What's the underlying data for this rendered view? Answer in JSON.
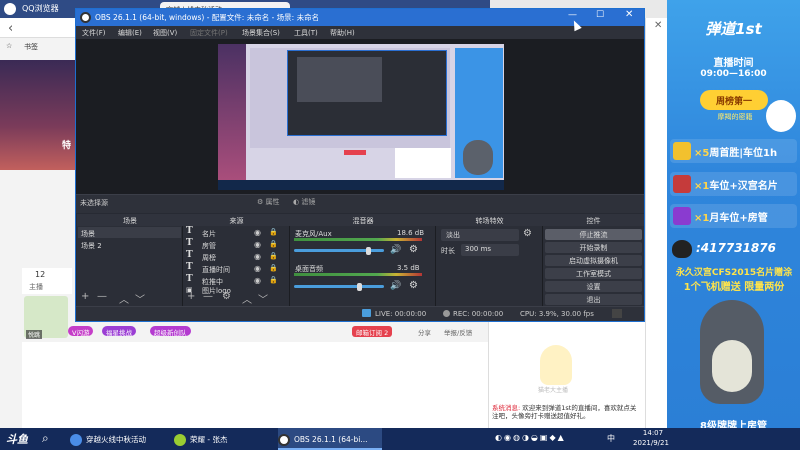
{
  "browser": {
    "app_name": "QQ浏览器",
    "tab_title": "穿越火线中秋活动",
    "bookmark_label": "书签",
    "hero_badge": "特",
    "stat_value": "12",
    "stat_label": "主播",
    "avatar_caption": "悦跳",
    "tags": [
      "V闪游",
      "福星挑战",
      "超级新创队"
    ],
    "share_button": "邮箱订阅 2",
    "share_label": "分享",
    "report_label": "举报/反馈",
    "mascot_caption": "猫老大主播",
    "chat_system_label": "系统消息:",
    "chat_message": "欢迎来到弹道1st的直播间，喜欢就点关注吧，头像旁打卡赠送超值好礼。"
  },
  "live_panel": {
    "title": "弹道1st",
    "time_label": "直播时间",
    "time_value": "09:00—16:00",
    "weekly_badge": "周榜第一",
    "weekly_sub": "摩羯的密籍",
    "rows": [
      {
        "mult": "×5",
        "text": "周首胜|车位1h"
      },
      {
        "mult": "×1",
        "text": "车位+汉宫名片"
      },
      {
        "mult": "×1",
        "text": "月车位+房管"
      }
    ],
    "qq": ":417731876",
    "promo_line1": "永久汉宫CFS2015名片赠涂",
    "promo_line2": "1个飞机赠送  限量两份",
    "footer": "8级牌牌上房管"
  },
  "obs": {
    "title": "OBS 26.1.1 (64-bit, windows) - 配置文件: 未命名 - 场景: 未命名",
    "menu": [
      {
        "label": "文件(F)",
        "dim": false
      },
      {
        "label": "编辑(E)",
        "dim": false
      },
      {
        "label": "视图(V)",
        "dim": false
      },
      {
        "label": "固定文件(P)",
        "dim": true
      },
      {
        "label": "场景集合(S)",
        "dim": false
      },
      {
        "label": "工具(T)",
        "dim": false
      },
      {
        "label": "帮助(H)",
        "dim": false
      }
    ],
    "no_source": "未选择源",
    "properties": "属性",
    "filters": "滤镜",
    "docks": {
      "scenes": "场景",
      "sources": "来源",
      "mixer": "混音器",
      "transitions": "转场特效",
      "controls": "控件"
    },
    "scenes": [
      "场景",
      "场景 2"
    ],
    "sources": [
      "名片",
      "房管",
      "周榜",
      "直播时间",
      "粒推中",
      "图片logo"
    ],
    "mixer": [
      {
        "name": "麦克风/Aux",
        "db": "18.6 dB",
        "level": 0.82
      },
      {
        "name": "桌面音频",
        "db": "3.5 dB",
        "level": 0.72
      }
    ],
    "transition": {
      "type": "淡出",
      "duration_label": "时长",
      "duration": "300 ms"
    },
    "controls": [
      "停止推流",
      "开始录制",
      "启动虚拟摄像机",
      "工作室模式",
      "设置",
      "退出"
    ],
    "status": {
      "live": "LIVE: 00:00:00",
      "rec": "REC: 00:00:00",
      "cpu": "CPU: 3.9%, 30.00 fps"
    }
  },
  "taskbar": {
    "start": "斗鱼",
    "apps": [
      "穿越火线中秋活动",
      "荣耀 - 张杰",
      "OBS 26.1.1 (64-bi..."
    ],
    "ime": "中",
    "time": "14:07",
    "date": "2021/9/21"
  }
}
